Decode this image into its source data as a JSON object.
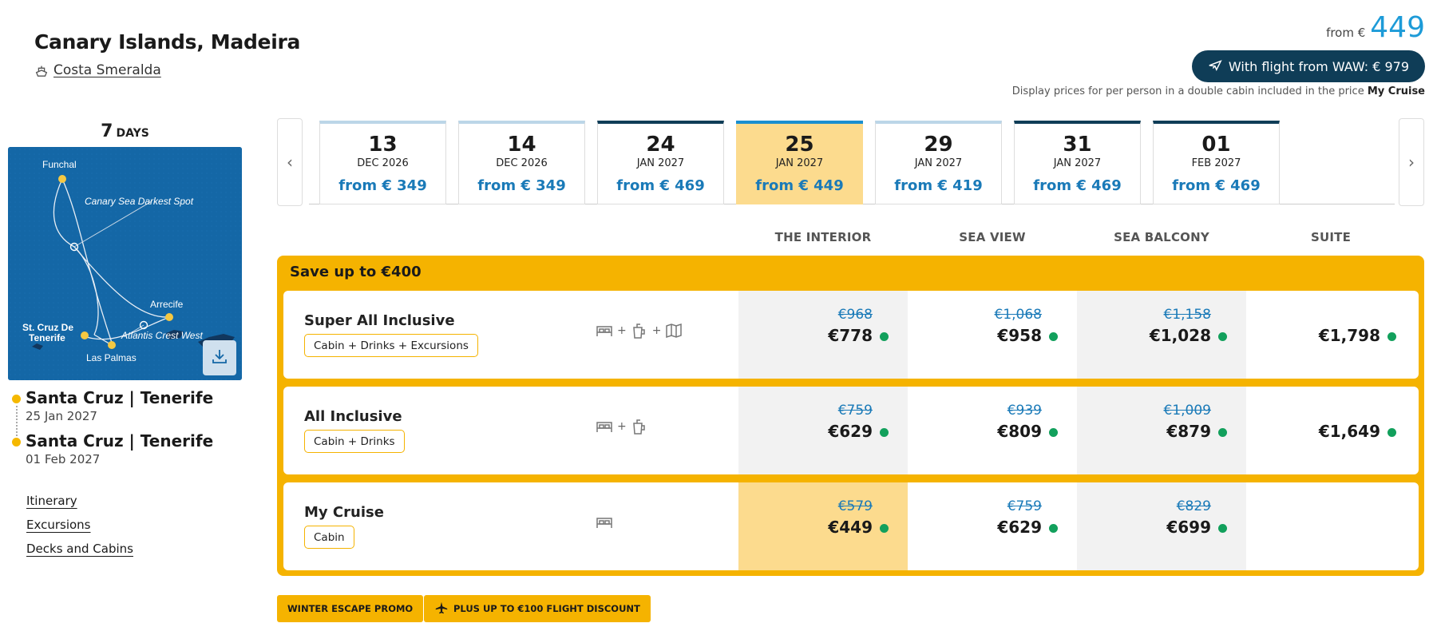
{
  "header": {
    "title": "Canary Islands, Madeira",
    "ship": "Costa Smeralda",
    "from_label": "from €",
    "from_value": "449",
    "flight_button": "With flight from WAW: € 979",
    "display_note_prefix": "Display prices for per person in a double cabin included in the price",
    "display_note_package": "My Cruise"
  },
  "duration": {
    "number": "7",
    "unit": "DAYS"
  },
  "map": {
    "labels": {
      "funchal": "Funchal",
      "darkest": "Canary Sea Darkest Spot",
      "arrecife": "Arrecife",
      "stcruz_1": "St. Cruz De",
      "stcruz_2": "Tenerife",
      "atlantis": "Atlantis Crest West",
      "laspalmas": "Las Palmas"
    }
  },
  "itinerary": [
    {
      "port": "Santa Cruz | Tenerife",
      "date": "25 Jan 2027"
    },
    {
      "port": "Santa Cruz | Tenerife",
      "date": "01 Feb 2027"
    }
  ],
  "links": [
    "Itinerary",
    "Excursions",
    "Decks and Cabins"
  ],
  "dates": [
    {
      "day": "13",
      "month": "DEC 2026",
      "price": "from € 349"
    },
    {
      "day": "14",
      "month": "DEC 2026",
      "price": "from € 349"
    },
    {
      "day": "24",
      "month": "JAN 2027",
      "price": "from € 469"
    },
    {
      "day": "25",
      "month": "JAN 2027",
      "price": "from € 449"
    },
    {
      "day": "29",
      "month": "JAN 2027",
      "price": "from € 419"
    },
    {
      "day": "31",
      "month": "JAN 2027",
      "price": "from € 469"
    },
    {
      "day": "01",
      "month": "FEB 2027",
      "price": "from € 469"
    }
  ],
  "cabin_types": [
    "THE INTERIOR",
    "SEA VIEW",
    "SEA BALCONY",
    "SUITE"
  ],
  "save_banner": "Save up to €400",
  "packages": [
    {
      "name": "Super All Inclusive",
      "tag": "Cabin + Drinks + Excursions",
      "prices": [
        {
          "old": "€968",
          "new": "€778"
        },
        {
          "old": "€1,068",
          "new": "€958"
        },
        {
          "old": "€1,158",
          "new": "€1,028"
        },
        {
          "old": "",
          "new": "€1,798"
        }
      ]
    },
    {
      "name": "All Inclusive",
      "tag": "Cabin + Drinks",
      "prices": [
        {
          "old": "€759",
          "new": "€629"
        },
        {
          "old": "€939",
          "new": "€809"
        },
        {
          "old": "€1,009",
          "new": "€879"
        },
        {
          "old": "",
          "new": "€1,649"
        }
      ]
    },
    {
      "name": "My Cruise",
      "tag": "Cabin",
      "prices": [
        {
          "old": "€579",
          "new": "€449"
        },
        {
          "old": "€759",
          "new": "€629"
        },
        {
          "old": "€829",
          "new": "€699"
        }
      ]
    }
  ],
  "promos": [
    "WINTER ESCAPE PROMO",
    "PLUS UP TO €100 FLIGHT DISCOUNT"
  ],
  "colors": {
    "accent_yellow": "#f5b300",
    "selected_bg": "#fcdb8e",
    "navy": "#0f3d57",
    "price_blue": "#1a7ab8",
    "available_green": "#12a05c"
  }
}
